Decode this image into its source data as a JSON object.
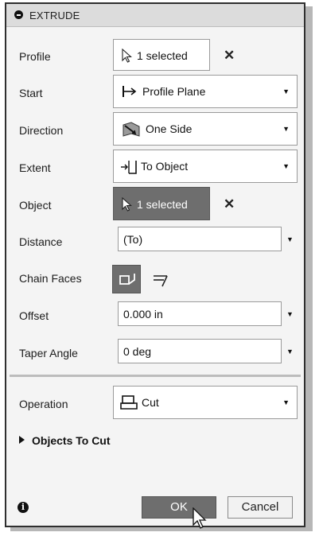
{
  "dialog": {
    "title": "EXTRUDE",
    "title_icon": "collapse-minus-icon"
  },
  "rows": {
    "profile": {
      "label": "Profile",
      "value": "1 selected",
      "icon": "select-arrow-icon"
    },
    "start": {
      "label": "Start",
      "value": "Profile Plane",
      "icon": "profile-plane-icon"
    },
    "direction": {
      "label": "Direction",
      "value": "One Side",
      "icon": "one-side-icon"
    },
    "extent": {
      "label": "Extent",
      "value": "To Object",
      "icon": "to-object-icon"
    },
    "object": {
      "label": "Object",
      "value": "1 selected",
      "icon": "select-arrow-icon"
    },
    "distance": {
      "label": "Distance",
      "value": "(To)"
    },
    "chain_faces": {
      "label": "Chain Faces"
    },
    "offset": {
      "label": "Offset",
      "value": "0.000 in"
    },
    "taper_angle": {
      "label": "Taper Angle",
      "value": "0 deg"
    },
    "operation": {
      "label": "Operation",
      "value": "Cut",
      "icon": "cut-operation-icon"
    }
  },
  "section": {
    "label": "Objects To Cut"
  },
  "footer": {
    "ok_label": "OK",
    "cancel_label": "Cancel"
  },
  "colors": {
    "dialog_bg": "#f4f4f4",
    "selected_dark": "#6e6e6e",
    "ok_button": "#6e6e6e"
  }
}
